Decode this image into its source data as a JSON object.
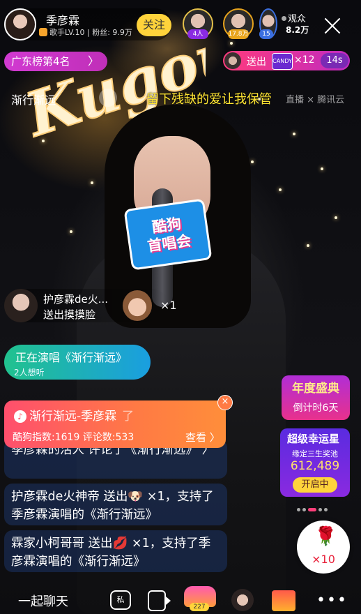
{
  "host": {
    "name": "季彦霖",
    "level_label": "歌手LV.10",
    "fans_label": "粉丝: 9.9万",
    "follow_label": "关注"
  },
  "top_viewers": [
    {
      "badge": "4人",
      "color": "#8a2be2"
    },
    {
      "badge": "17.8万",
      "color": "#e8a41c"
    },
    {
      "badge": "15",
      "color": "#3b6fe0"
    }
  ],
  "audience": {
    "label": "观众",
    "count": "8.2万"
  },
  "rank_label": "广东榜第4名",
  "gift_notice": {
    "sent_label": "送出",
    "gift_icon_text": "CANDY",
    "count": "×12",
    "seconds": "14s"
  },
  "lyrics": {
    "previous": "渐行渐远",
    "current": "留下残缺的爱让我保管",
    "watermark": "直播 × 腾讯云"
  },
  "gift_pop": {
    "user": "护彦霖de火...",
    "action": "送出摸摸脸",
    "count": "×1"
  },
  "singing": {
    "line1": "正在演唱《渐行渐远》",
    "line2": "2人想听"
  },
  "song_card": {
    "title": "渐行渐远-季彦霖",
    "stats": "酷狗指数:1619  评论数:533",
    "view_label": "查看 〉",
    "faded_text": "了"
  },
  "chat": [
    {
      "text": "季彦霖的活人 评论了《渐行渐远》 〉"
    },
    {
      "text": "护彦霖de火神帝 送出🐶 ×1，支持了季彦霖演唱的《渐行渐远》"
    },
    {
      "text": "霖家小柯哥哥 送出💋 ×1，支持了季彦霖演唱的《渐行渐远》"
    }
  ],
  "promo1": {
    "title": "年度盛典",
    "countdown": "倒计时6天"
  },
  "promo2": {
    "title": "超级幸运星",
    "subtitle": "缘定三生奖池",
    "number": "612,489",
    "button": "开启中"
  },
  "rose": {
    "count": "×10"
  },
  "bottom": {
    "chat_label": "一起聊天",
    "msg_label": "私",
    "crown_count": "227",
    "more": "•••"
  },
  "mic_flag": {
    "line1": "酷狗",
    "line2": "首唱会"
  },
  "neon_text": "Kugou"
}
